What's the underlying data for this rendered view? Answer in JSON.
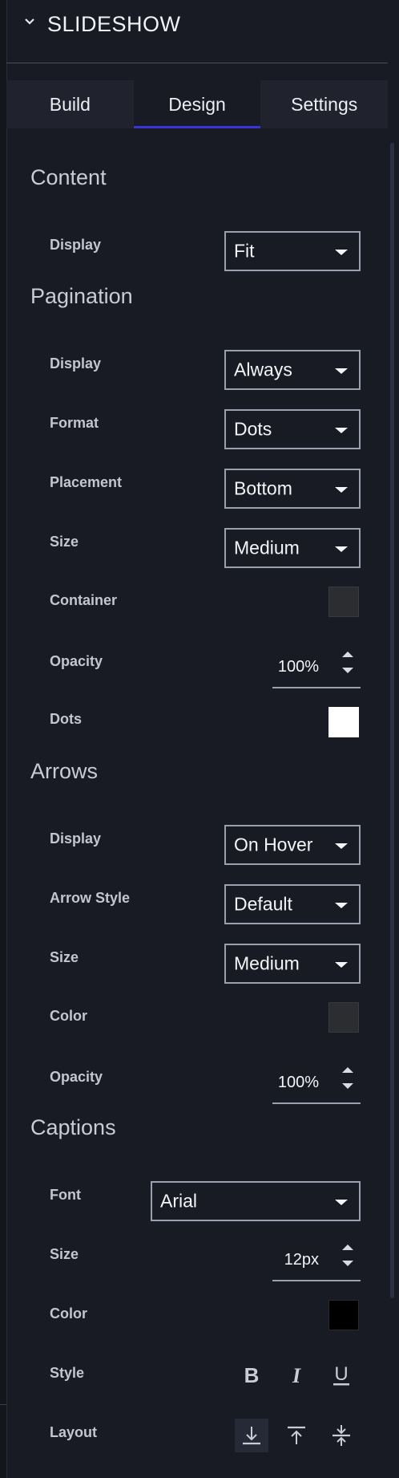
{
  "header": {
    "title": "SLIDESHOW"
  },
  "tabs": [
    {
      "label": "Build",
      "active": false
    },
    {
      "label": "Design",
      "active": true
    },
    {
      "label": "Settings",
      "active": false
    }
  ],
  "content": {
    "title": "Content",
    "display_label": "Display",
    "display_value": "Fit"
  },
  "pagination": {
    "title": "Pagination",
    "display_label": "Display",
    "display_value": "Always",
    "format_label": "Format",
    "format_value": "Dots",
    "placement_label": "Placement",
    "placement_value": "Bottom",
    "size_label": "Size",
    "size_value": "Medium",
    "container_label": "Container",
    "container_color": "#2c2d31",
    "opacity_label": "Opacity",
    "opacity_value": "100%",
    "dots_label": "Dots",
    "dots_color": "#ffffff"
  },
  "arrows": {
    "title": "Arrows",
    "display_label": "Display",
    "display_value": "On Hover",
    "style_label": "Arrow Style",
    "style_value": "Default",
    "size_label": "Size",
    "size_value": "Medium",
    "color_label": "Color",
    "color_value": "#2c2d31",
    "opacity_label": "Opacity",
    "opacity_value": "100%"
  },
  "captions": {
    "title": "Captions",
    "font_label": "Font",
    "font_value": "Arial",
    "size_label": "Size",
    "size_value": "12px",
    "color_label": "Color",
    "color_value": "#000000",
    "style_label": "Style",
    "layout_label": "Layout",
    "style_icons": [
      "bold-icon",
      "italic-icon",
      "underline-icon"
    ],
    "layout_icons": [
      "align-bottom-icon",
      "align-top-icon",
      "align-center-icon"
    ]
  },
  "colors": {
    "background": "#181b24",
    "tab_indicator": "#3a33d6"
  }
}
